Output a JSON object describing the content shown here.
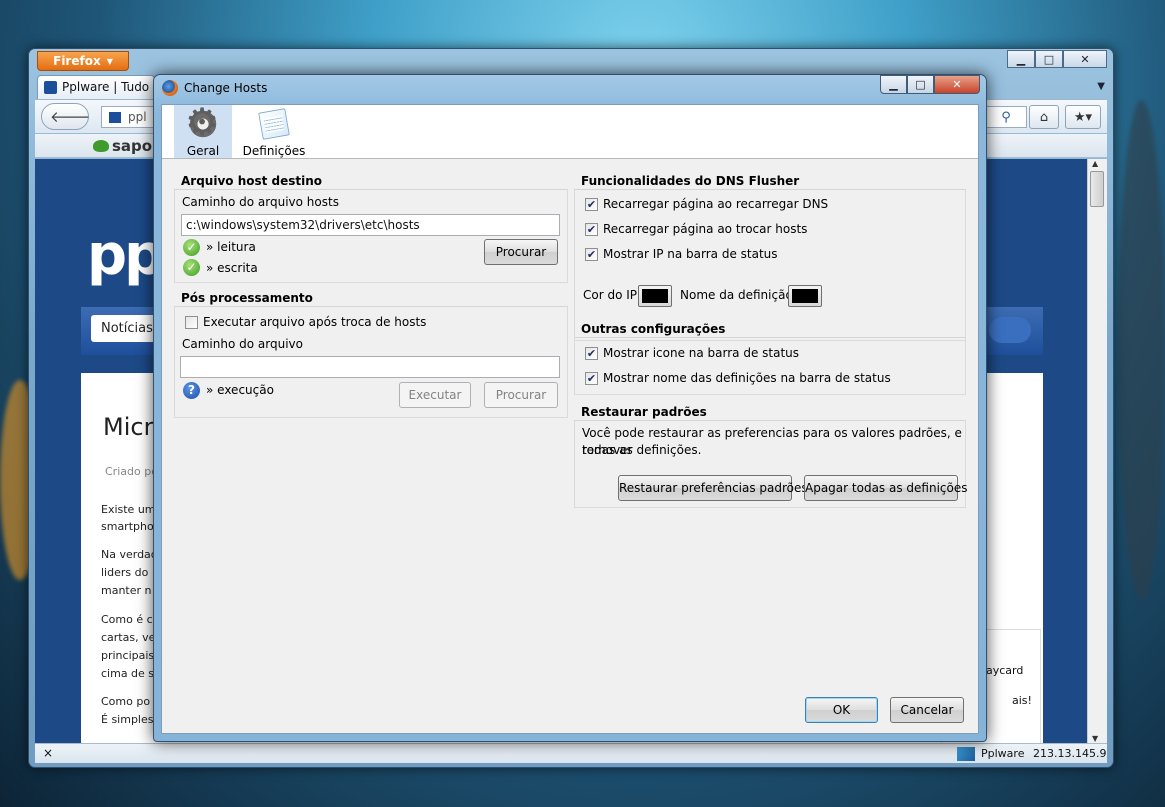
{
  "browser": {
    "menu_button": "Firefox",
    "tab_title": "Pplware | Tudo so",
    "url_partial": "ppl",
    "bookmark_sapo": "sapo",
    "status_site": "Pplware",
    "status_ip": "213.13.145.9",
    "status_close": "×"
  },
  "website": {
    "logo": "pp",
    "nav_item": "Notícias",
    "article_heading": "Micro",
    "meta": "Criado po",
    "paragraphs": [
      "Existe um",
      "smartpho",
      "Na verdad",
      "liders do",
      "manter n",
      "Como é c",
      "cartas, ve",
      "principais",
      "cima de s",
      "Como po",
      "É simples"
    ],
    "sidebar_1": "aycard",
    "sidebar_2": "ais!"
  },
  "dialog": {
    "title": "Change Hosts",
    "tabs": [
      {
        "label": "Geral",
        "icon": "gear-icon",
        "active": true
      },
      {
        "label": "Definições",
        "icon": "notepad-icon",
        "active": false
      }
    ],
    "hosts_group": {
      "title": "Arquivo host destino",
      "path_label": "Caminho do arquivo hosts",
      "path_value": "c:\\windows\\system32\\drivers\\etc\\hosts",
      "read_label": "» leitura",
      "write_label": "» escrita",
      "browse_button": "Procurar"
    },
    "post_group": {
      "title": "Pós processamento",
      "run_checkbox": "Executar arquivo após troca de hosts",
      "run_checked": false,
      "file_label": "Caminho do arquivo",
      "file_value": "",
      "exec_label": "» execução",
      "run_button": "Executar",
      "browse_button": "Procurar"
    },
    "dns_group": {
      "title": "Funcionalidades do DNS Flusher",
      "options": [
        {
          "label": "Recarregar página ao recarregar DNS",
          "checked": true
        },
        {
          "label": "Recarregar página ao trocar hosts",
          "checked": true
        },
        {
          "label": "Mostrar IP na barra de status",
          "checked": true
        }
      ],
      "ip_color_label": "Cor do IP",
      "name_color_label": "Nome da definição",
      "ip_color": "#000000",
      "name_color": "#000000"
    },
    "other_group": {
      "title": "Outras configurações",
      "options": [
        {
          "label": "Mostrar icone na barra de status",
          "checked": true
        },
        {
          "label": "Mostrar nome das definições na barra de status",
          "checked": true
        }
      ]
    },
    "restore_group": {
      "title": "Restaurar padrões",
      "text_line1": "Você pode restaurar as preferencias para os valores padrões, e remover",
      "text_line2": "todas as definições.",
      "restore_button": "Restaurar preferências padrões",
      "delete_button": "Apagar todas as definições"
    },
    "ok_button": "OK",
    "cancel_button": "Cancelar",
    "check_mark": "✔"
  }
}
